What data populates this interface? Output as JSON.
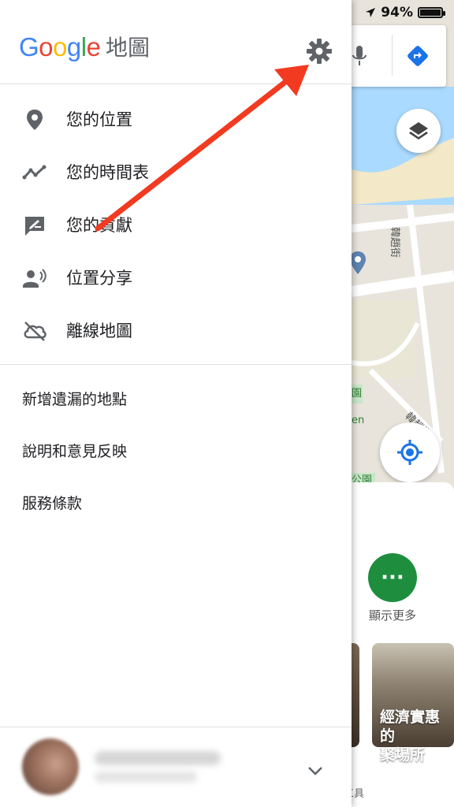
{
  "status_bar": {
    "battery_percent": "94%",
    "battery_level": 0.94
  },
  "drawer": {
    "logo_text": "Google",
    "logo_suffix": "地圖",
    "menu": [
      {
        "label": "您的位置",
        "icon": "location-pin-icon"
      },
      {
        "label": "您的時間表",
        "icon": "timeline-icon"
      },
      {
        "label": "您的貢獻",
        "icon": "contribute-icon"
      },
      {
        "label": "位置分享",
        "icon": "location-share-icon"
      },
      {
        "label": "離線地圖",
        "icon": "offline-cloud-icon"
      }
    ],
    "links": [
      {
        "label": "新增遺漏的地點"
      },
      {
        "label": "說明和意見反映"
      },
      {
        "label": "服務條款"
      }
    ]
  },
  "map": {
    "street_label_1": "韓趙街",
    "street_label_2": "韓趙街",
    "park_label": "公園",
    "park_label_2": "園",
    "park_label_3": "en",
    "more_label": "顯示更多",
    "card_title_line1": "經濟實惠的",
    "card_title_line2": "聚場所",
    "tools_label": "工具"
  },
  "colors": {
    "annotation_arrow": "#f23a21",
    "more_button": "#1e8e3e",
    "directions": "#1a73e8"
  }
}
